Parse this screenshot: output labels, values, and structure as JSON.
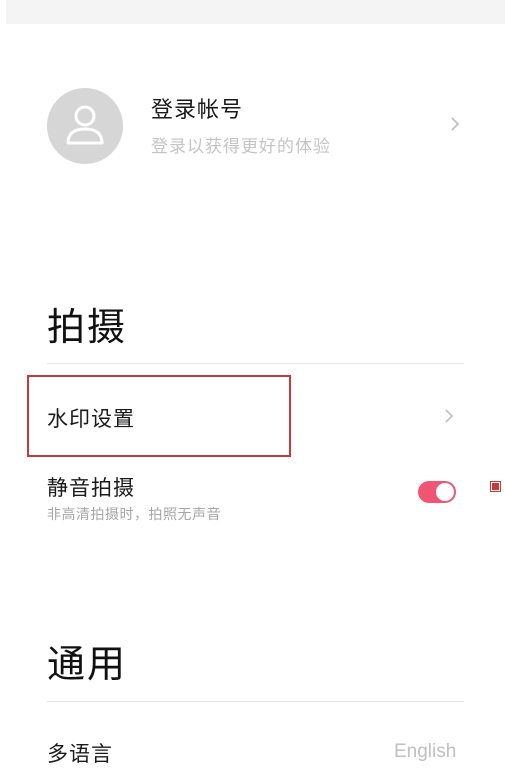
{
  "account": {
    "title": "登录帐号",
    "subtitle": "登录以获得更好的体验",
    "avatar_icon": "user-icon",
    "chevron_icon": "chevron-right-icon"
  },
  "sections": {
    "shoot": {
      "title": "拍摄",
      "watermark": {
        "label": "水印设置",
        "chevron_icon": "chevron-right-icon"
      },
      "silent": {
        "label": "静音拍摄",
        "subtitle": "非高清拍摄时，拍照无声音",
        "toggle_on": true
      }
    },
    "general": {
      "title": "通用",
      "language": {
        "label": "多语言",
        "value": "English"
      }
    }
  },
  "colors": {
    "toggle_on": "#f05672",
    "highlight": "#c9393b",
    "muted_text": "#c4c4c4"
  }
}
